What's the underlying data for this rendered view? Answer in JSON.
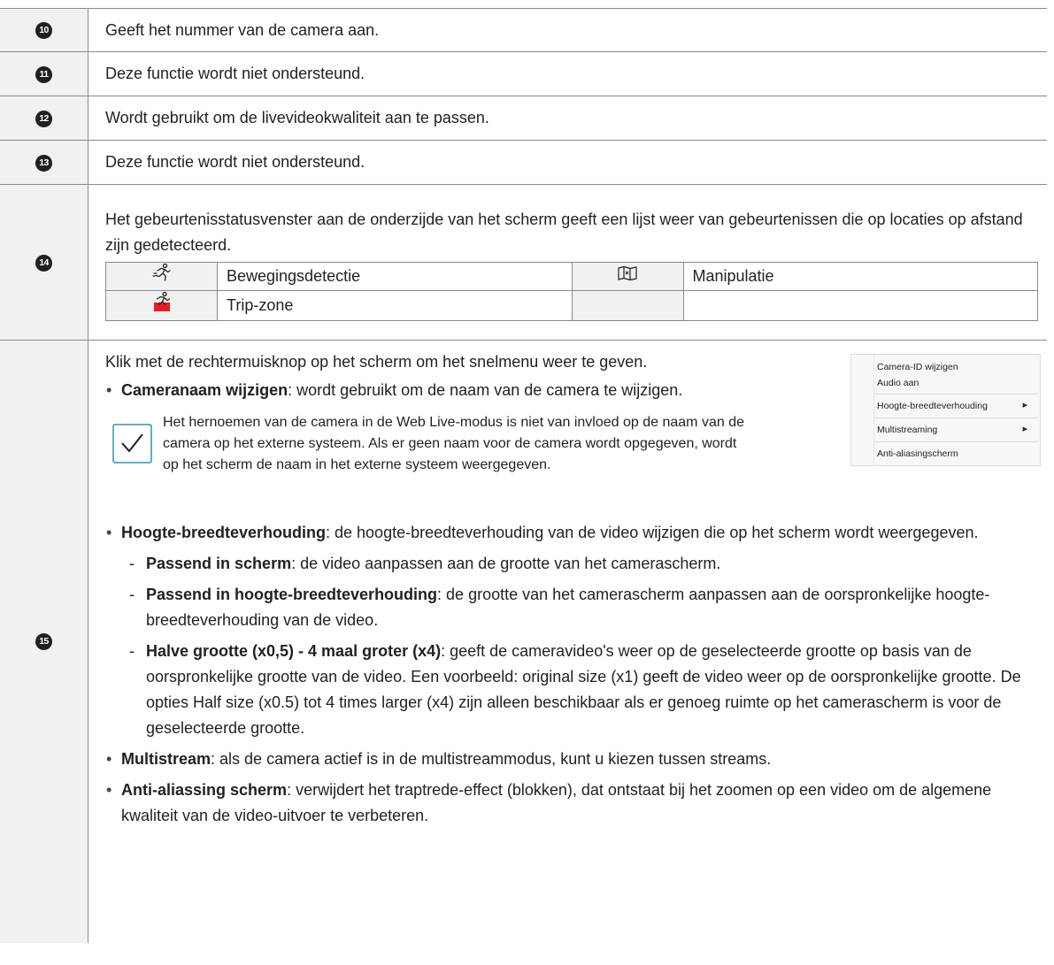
{
  "rows": [
    {
      "num": "10",
      "text": "Geeft het nummer van de camera aan."
    },
    {
      "num": "11",
      "text": "Deze functie wordt niet ondersteund."
    },
    {
      "num": "12",
      "text": "Wordt gebruikt om de livevideokwaliteit aan te passen."
    },
    {
      "num": "13",
      "text": "Deze functie wordt niet ondersteund."
    }
  ],
  "row14": {
    "num": "14",
    "text": "Het gebeurtenisstatusvenster aan de onderzijde van het scherm geeft een lijst weer van gebeurtenissen die op locaties op afstand zijn gedetecteerd.",
    "events": [
      {
        "icon": "motion-detection-icon",
        "label": "Bewegingsdetectie"
      },
      {
        "icon": "tampering-icon",
        "label": "Manipulatie"
      },
      {
        "icon": "trip-zone-icon",
        "label": "Trip-zone"
      },
      {
        "icon": "",
        "label": ""
      }
    ]
  },
  "row15": {
    "num": "15",
    "intro": "Klik met de rechtermuisknop op het scherm om het snelmenu weer te geven.",
    "rename_title": "Cameranaam wijzigen",
    "rename_text": ": wordt gebruikt om de naam van de camera te wijzigen.",
    "note": "Het hernoemen van de camera in de Web Live-modus is niet van invloed op de naam van de camera op het externe systeem. Als er geen naam voor de camera wordt opgegeven, wordt op het scherm de naam in het externe systeem weergegeven.",
    "aspect_title": "Hoogte-breedteverhouding",
    "aspect_text": ": de hoogte-breedteverhouding van de video wijzigen die op het scherm wordt weergegeven.",
    "fit_title": "Passend in scherm",
    "fit_text": ": de video aanpassen aan de grootte van het camerascherm.",
    "fitratio_title": "Passend in hoogte-breedteverhouding",
    "fitratio_text": ": de grootte van het camerascherm aanpassen aan de oorspronkelijke hoogte-breedteverhouding van de video.",
    "half_title": "Halve grootte (x0,5) - 4 maal groter (x4)",
    "half_text": ": geeft de cameravideo's weer op de geselecteerde grootte op basis van de oorspronkelijke grootte van de video. Een voorbeeld: original size (x1) geeft de video weer op de oorspronkelijke grootte. De opties Half size (x0.5) tot 4 times larger (x4) zijn alleen beschikbaar als er genoeg ruimte op het camerascherm is voor de geselecteerde grootte.",
    "multi_title": "Multistream",
    "multi_text": ": als de camera actief is in de multistreammodus, kunt u kiezen tussen streams.",
    "aa_title": "Anti-aliassing scherm",
    "aa_text": ": verwijdert het traptrede-effect (blokken), dat ontstaat bij het zoomen op een video om de algemene kwaliteit van de video-uitvoer te verbeteren.",
    "context_menu": [
      "Camera-ID wijzigen",
      "Audio aan",
      "Hoogte-breedteverhouding",
      "Multistreaming",
      "Anti-aliasingscherm"
    ]
  }
}
